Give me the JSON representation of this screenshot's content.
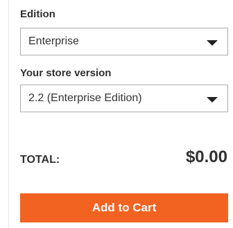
{
  "product_options": {
    "edition": {
      "label": "Edition",
      "selected": "Enterprise"
    },
    "store_version": {
      "label": "Your store version",
      "selected": "2.2 (Enterprise Edition)"
    }
  },
  "summary": {
    "total_label": "TOTAL:",
    "total_value": "$0.00"
  },
  "actions": {
    "add_to_cart_label": "Add to Cart"
  },
  "colors": {
    "accent": "#f26322",
    "text": "#303030",
    "border": "#adadad"
  },
  "icons": {
    "select_caret": "caret-down-icon"
  }
}
